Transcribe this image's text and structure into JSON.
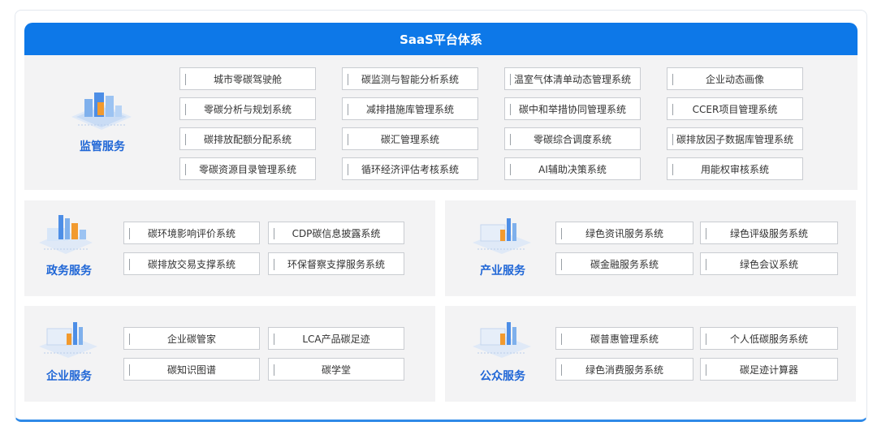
{
  "header": {
    "title": "SaaS平台体系"
  },
  "supervision": {
    "label": "监管服务",
    "rows": [
      [
        "城市零碳驾驶舱",
        "碳监测与智能分析系统",
        "温室气体清单动态管理系统",
        "企业动态画像"
      ],
      [
        "零碳分析与规划系统",
        "减排措施库管理系统",
        "碳中和举措协同管理系统",
        "CCER项目管理系统"
      ],
      [
        "碳排放配额分配系统",
        "碳汇管理系统",
        "零碳综合调度系统",
        "碳排放因子数据库管理系统"
      ],
      [
        "零碳资源目录管理系统",
        "循环经济评估考核系统",
        "AI辅助决策系统",
        "用能权审核系统"
      ]
    ]
  },
  "government": {
    "label": "政务服务",
    "rows": [
      [
        "碳环境影响评价系统",
        "CDP碳信息披露系统"
      ],
      [
        "碳排放交易支撑系统",
        "环保督察支撑服务系统"
      ]
    ]
  },
  "industry": {
    "label": "产业服务",
    "rows": [
      [
        "绿色资讯服务系统",
        "绿色评级服务系统"
      ],
      [
        "碳金融服务系统",
        "绿色会议系统"
      ]
    ]
  },
  "enterprise": {
    "label": "企业服务",
    "rows": [
      [
        "企业碳管家",
        "LCA产品碳足迹"
      ],
      [
        "碳知识图谱",
        "碳学堂"
      ]
    ]
  },
  "public": {
    "label": "公众服务",
    "rows": [
      [
        "碳普惠管理系统",
        "个人低碳服务系统"
      ],
      [
        "绿色消费服务系统",
        "碳足迹计算器"
      ]
    ]
  },
  "colors": {
    "header": "#0d78e8",
    "label": "#1f66d6",
    "panel": "#f3f3f4"
  }
}
